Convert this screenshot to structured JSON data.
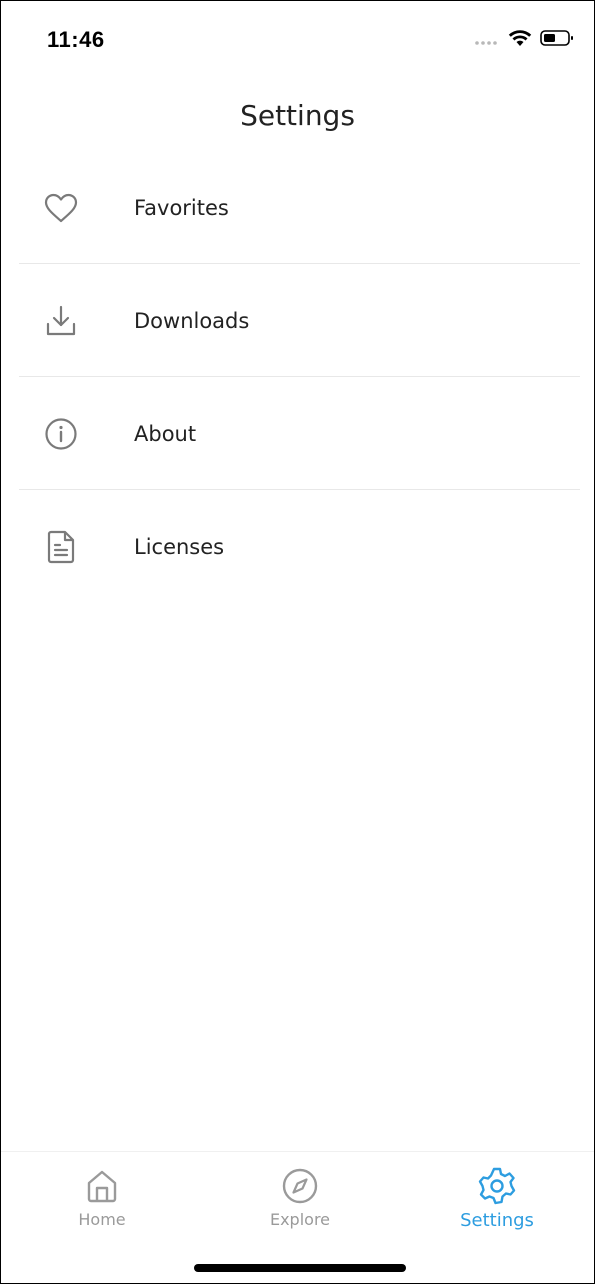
{
  "status_bar": {
    "time": "11:46"
  },
  "header": {
    "title": "Settings"
  },
  "menu": {
    "items": [
      {
        "label": "Favorites",
        "icon": "heart-icon"
      },
      {
        "label": "Downloads",
        "icon": "download-icon"
      },
      {
        "label": "About",
        "icon": "info-icon"
      },
      {
        "label": "Licenses",
        "icon": "document-icon"
      }
    ]
  },
  "tab_bar": {
    "tabs": [
      {
        "label": "Home",
        "icon": "home-icon",
        "active": false
      },
      {
        "label": "Explore",
        "icon": "compass-icon",
        "active": false
      },
      {
        "label": "Settings",
        "icon": "gear-icon",
        "active": true
      }
    ]
  },
  "colors": {
    "accent": "#2d9de0",
    "inactive": "#9a9a9a",
    "icon": "#7a7a7a",
    "divider": "#e8e8e8",
    "text": "#222222"
  }
}
